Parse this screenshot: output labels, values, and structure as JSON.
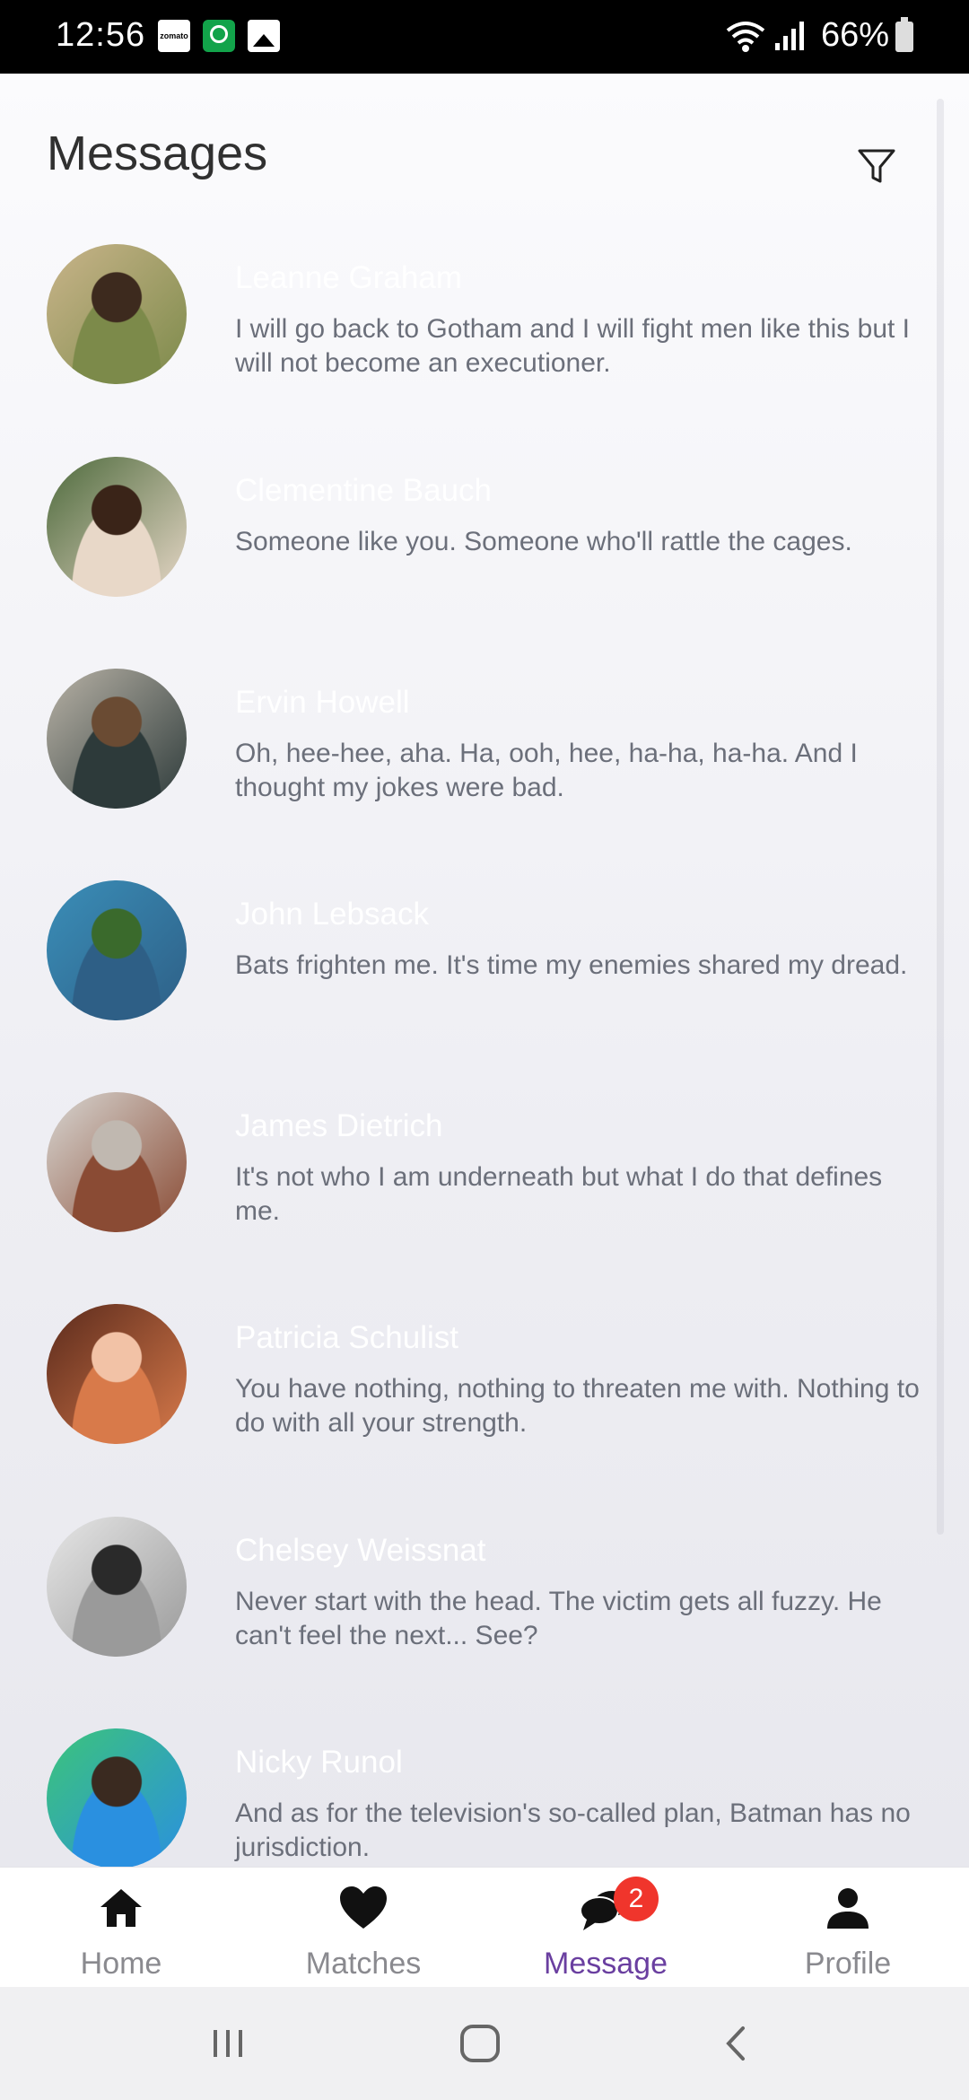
{
  "status_bar": {
    "time": "12:56",
    "battery": "66%",
    "notification_icons": [
      "zomato-icon",
      "whatsapp-icon",
      "gallery-icon"
    ],
    "zomato_text": "zomato"
  },
  "header": {
    "title": "Messages",
    "filter_icon": "filter-icon"
  },
  "messages": [
    {
      "name": "Leanne Graham",
      "text": "I will go back to Gotham and I will fight men like this but I will not become an executioner.",
      "avatar_colors": [
        "#c9b48a",
        "#7c8a4a",
        "#3d2a1e"
      ]
    },
    {
      "name": "Clementine Bauch",
      "text": "Someone like you. Someone who'll rattle the cages.",
      "avatar_colors": [
        "#4d6a3c",
        "#e8d8c8",
        "#3a2418"
      ]
    },
    {
      "name": "Ervin Howell",
      "text": "Oh, hee-hee, aha. Ha, ooh, hee, ha-ha, ha-ha. And I thought my jokes were bad.",
      "avatar_colors": [
        "#b8b2a6",
        "#2d3a3a",
        "#6a4b33"
      ]
    },
    {
      "name": "John Lebsack",
      "text": "Bats frighten me. It's time my enemies shared my dread.",
      "avatar_colors": [
        "#3a8eb8",
        "#2e5f86",
        "#3a6a2c"
      ]
    },
    {
      "name": "James Dietrich",
      "text": "It's not who I am underneath but what I do that defines me.",
      "avatar_colors": [
        "#d7d6d2",
        "#8a4b34",
        "#c0b8b0"
      ]
    },
    {
      "name": "Patricia Schulist",
      "text": "You have nothing, nothing to threaten me with. Nothing to do with all your strength.",
      "avatar_colors": [
        "#5a2a1c",
        "#d87a4a",
        "#f2c2a6"
      ]
    },
    {
      "name": "Chelsey Weissnat",
      "text": "Never start with the head. The victim gets all fuzzy. He can't feel the next... See?",
      "avatar_colors": [
        "#e6e6e6",
        "#9a9a9a",
        "#2a2a2a"
      ]
    },
    {
      "name": "Nicky Runol",
      "text": "And as for the television's so-called plan, Batman has no jurisdiction.",
      "avatar_colors": [
        "#3cc47a",
        "#2a90e0",
        "#3a2a20"
      ]
    }
  ],
  "bottom_nav": {
    "items": [
      {
        "label": "Home",
        "icon": "home-icon"
      },
      {
        "label": "Matches",
        "icon": "heart-icon"
      },
      {
        "label": "Message",
        "icon": "chat-bubbles-icon",
        "badge": "2",
        "active": true
      },
      {
        "label": "Profile",
        "icon": "person-icon"
      }
    ],
    "active_color": "#6a3fa0",
    "badge_color": "#f0352c"
  },
  "system_nav": {
    "buttons": [
      "recent-apps-icon",
      "home-circle-icon",
      "back-icon"
    ]
  }
}
